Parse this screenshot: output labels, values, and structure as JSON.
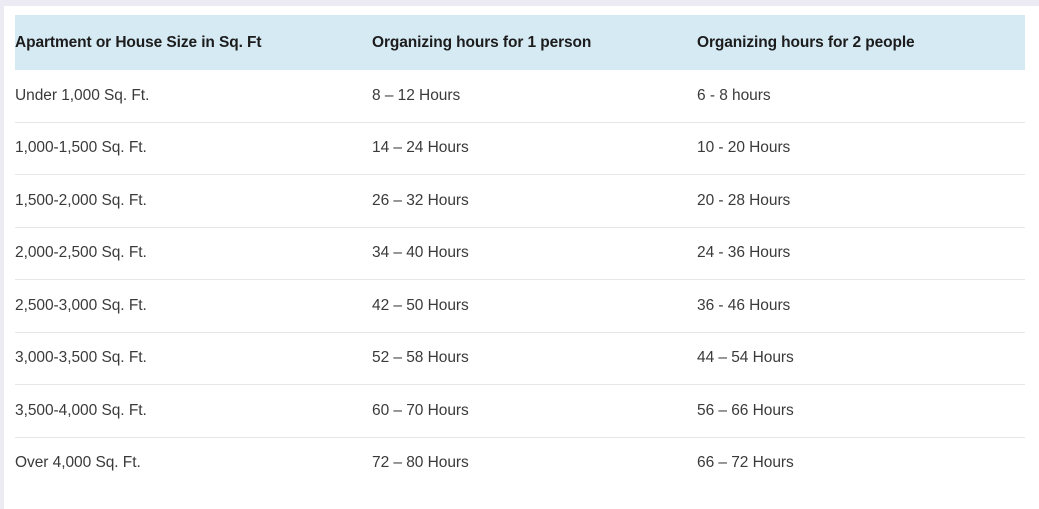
{
  "colors": {
    "header_background": "#d6eaf4",
    "header_text": "#1c1c1c",
    "body_text": "#3a3a3a",
    "row_divider": "#e6e6e6",
    "page_rule": "#eceaf3",
    "page_background": "#ffffff"
  },
  "table": {
    "columns": [
      "Apartment or House Size in Sq. Ft",
      "Organizing hours for 1 person",
      "Organizing hours for 2 people"
    ],
    "rows": [
      {
        "size": "Under 1,000 Sq. Ft.",
        "hours_one_person": "8 – 12 Hours",
        "hours_two_people": "6 - 8 hours"
      },
      {
        "size": "1,000-1,500 Sq. Ft.",
        "hours_one_person": "14 – 24 Hours",
        "hours_two_people": "10 - 20 Hours"
      },
      {
        "size": "1,500-2,000 Sq. Ft.",
        "hours_one_person": "26 – 32 Hours",
        "hours_two_people": "20 - 28 Hours"
      },
      {
        "size": "2,000-2,500 Sq. Ft.",
        "hours_one_person": "34 – 40 Hours",
        "hours_two_people": "24 - 36 Hours"
      },
      {
        "size": "2,500-3,000 Sq. Ft.",
        "hours_one_person": "42 – 50 Hours",
        "hours_two_people": "36 - 46 Hours"
      },
      {
        "size": "3,000-3,500 Sq. Ft.",
        "hours_one_person": "52 – 58 Hours",
        "hours_two_people": "44 – 54 Hours"
      },
      {
        "size": "3,500-4,000 Sq. Ft.",
        "hours_one_person": "60 – 70 Hours",
        "hours_two_people": "56 – 66 Hours"
      },
      {
        "size": "Over 4,000 Sq. Ft.",
        "hours_one_person": "72 – 80 Hours",
        "hours_two_people": "66 – 72 Hours"
      }
    ]
  }
}
